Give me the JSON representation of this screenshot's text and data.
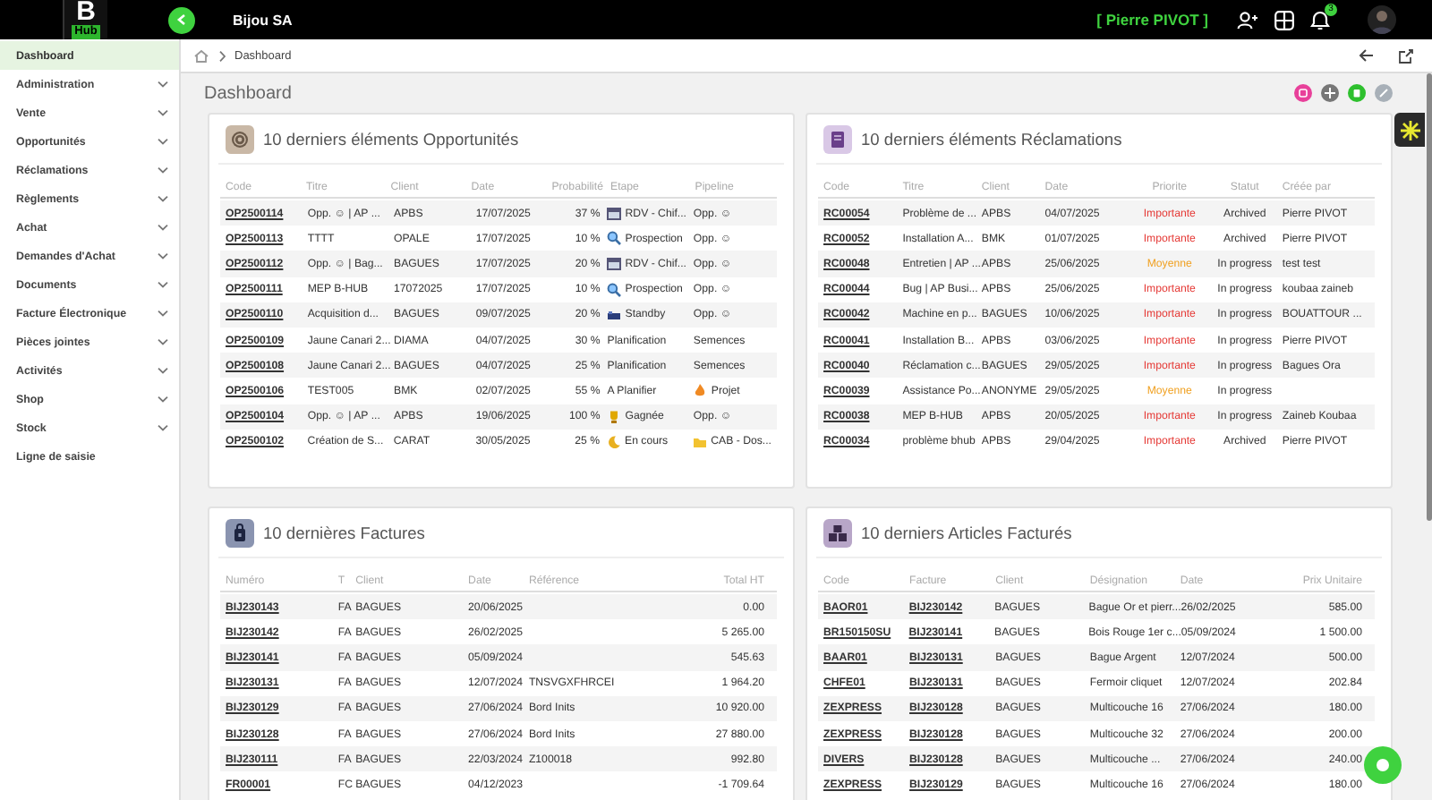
{
  "header": {
    "logo_top": "B",
    "logo_bottom": "Hub",
    "company": "Bijou SA",
    "user": "[ Pierre PIVOT ]",
    "notification_count": "3"
  },
  "sidebar": {
    "items": [
      {
        "label": "Dashboard",
        "selected": true,
        "expandable": false
      },
      {
        "label": "Administration",
        "selected": false,
        "expandable": true
      },
      {
        "label": "Vente",
        "selected": false,
        "expandable": true
      },
      {
        "label": "Opportunités",
        "selected": false,
        "expandable": true
      },
      {
        "label": "Réclamations",
        "selected": false,
        "expandable": true
      },
      {
        "label": "Règlements",
        "selected": false,
        "expandable": true
      },
      {
        "label": "Achat",
        "selected": false,
        "expandable": true
      },
      {
        "label": "Demandes d'Achat",
        "selected": false,
        "expandable": true
      },
      {
        "label": "Documents",
        "selected": false,
        "expandable": true
      },
      {
        "label": "Facture Électronique",
        "selected": false,
        "expandable": true
      },
      {
        "label": "Pièces jointes",
        "selected": false,
        "expandable": true
      },
      {
        "label": "Activités",
        "selected": false,
        "expandable": true
      },
      {
        "label": "Shop",
        "selected": false,
        "expandable": true
      },
      {
        "label": "Stock",
        "selected": false,
        "expandable": true
      },
      {
        "label": "Ligne de saisie",
        "selected": false,
        "expandable": false
      }
    ]
  },
  "breadcrumb": [
    "Dashboard"
  ],
  "page_title": "Dashboard",
  "cards": [
    {
      "title": "10 derniers éléments Opportunités",
      "color": "#c9b8a6",
      "columns": [
        {
          "label": "Code",
          "kind": "link"
        },
        {
          "label": "Titre",
          "kind": "text"
        },
        {
          "label": "Client",
          "kind": "text"
        },
        {
          "label": "Date",
          "kind": "text"
        },
        {
          "label": "Probabilité",
          "kind": "number"
        },
        {
          "label": "Etape",
          "kind": "text"
        },
        {
          "label": "Pipeline",
          "kind": "text"
        }
      ],
      "rows": [
        {
          "cells": [
            "OP2500114",
            "Opp. ☺ | AP ...",
            "APBS",
            "17/07/2025",
            "37 %",
            {
              "text": "RDV - Chif...",
              "kind": "calendar"
            },
            "Opp. ☺"
          ]
        },
        {
          "cells": [
            "OP2500113",
            "TTTT",
            "OPALE",
            "17/07/2025",
            "10 %",
            {
              "text": "Prospection",
              "kind": "search"
            },
            "Opp. ☺"
          ]
        },
        {
          "cells": [
            "OP2500112",
            "Opp. ☺ | Bag...",
            "BAGUES",
            "17/07/2025",
            "20 %",
            {
              "text": "RDV - Chif...",
              "kind": "calendar"
            },
            "Opp. ☺"
          ]
        },
        {
          "cells": [
            "OP2500111",
            "MEP B-HUB",
            "17072025",
            "17/07/2025",
            "10 %",
            {
              "text": "Prospection",
              "kind": "search"
            },
            "Opp. ☺"
          ]
        },
        {
          "cells": [
            "OP2500110",
            "Acquisition d...",
            "BAGUES",
            "09/07/2025",
            "20 %",
            {
              "text": "Standby",
              "kind": "bed"
            },
            "Opp. ☺"
          ]
        },
        {
          "cells": [
            "OP2500109",
            "Jaune Canari 2...",
            "DIAMA",
            "04/07/2025",
            "30 %",
            "Planification",
            "Semences"
          ]
        },
        {
          "cells": [
            "OP2500108",
            "Jaune Canari 2...",
            "BAGUES",
            "04/07/2025",
            "25 %",
            "Planification",
            "Semences"
          ]
        },
        {
          "cells": [
            "OP2500106",
            "TEST005",
            "BMK",
            "02/07/2025",
            "55 %",
            "A Planifier",
            {
              "text": "Projet",
              "kind": "flame"
            }
          ]
        },
        {
          "cells": [
            "OP2500104",
            "Opp. ☺ | AP ...",
            "APBS",
            "19/06/2025",
            "100 %",
            {
              "text": "Gagnée",
              "kind": "trophy"
            },
            "Opp. ☺"
          ]
        },
        {
          "cells": [
            "OP2500102",
            "Création de S...",
            "CARAT",
            "30/05/2025",
            "25 %",
            {
              "text": "En cours",
              "kind": "moon"
            },
            {
              "text": "CAB - Dos...",
              "kind": "folder"
            }
          ]
        }
      ]
    },
    {
      "title": "10 derniers éléments Réclamations",
      "color": "#d9c8e6",
      "columns": [
        {
          "label": "Code",
          "kind": "link"
        },
        {
          "label": "Titre",
          "kind": "text"
        },
        {
          "label": "Client",
          "kind": "text"
        },
        {
          "label": "Date",
          "kind": "text"
        },
        {
          "label": "Priorite",
          "kind": "center"
        },
        {
          "label": "Statut",
          "kind": "center"
        },
        {
          "label": "Créée par",
          "kind": "text"
        }
      ],
      "rows": [
        {
          "cells": [
            "RC00054",
            "Problème de ...",
            "APBS",
            "04/07/2025",
            {
              "text": "Importante",
              "color": "#e53935"
            },
            "Archived",
            "Pierre PIVOT"
          ]
        },
        {
          "cells": [
            "RC00052",
            "Installation A...",
            "BMK",
            "01/07/2025",
            {
              "text": "Importante",
              "color": "#e53935"
            },
            "Archived",
            "Pierre PIVOT"
          ]
        },
        {
          "cells": [
            "RC00048",
            "Entretien | AP ...",
            "APBS",
            "25/06/2025",
            {
              "text": "Moyenne",
              "color": "#f0a020"
            },
            "In progress",
            "test test"
          ]
        },
        {
          "cells": [
            "RC00044",
            "Bug | AP Busi...",
            "APBS",
            "25/06/2025",
            {
              "text": "Importante",
              "color": "#e53935"
            },
            "In progress",
            "koubaa zaineb"
          ]
        },
        {
          "cells": [
            "RC00042",
            "Machine en p...",
            "BAGUES",
            "10/06/2025",
            {
              "text": "Importante",
              "color": "#e53935"
            },
            "In progress",
            "BOUATTOUR ..."
          ]
        },
        {
          "cells": [
            "RC00041",
            "Installation B...",
            "APBS",
            "03/06/2025",
            {
              "text": "Importante",
              "color": "#e53935"
            },
            "In progress",
            "Pierre PIVOT"
          ]
        },
        {
          "cells": [
            "RC00040",
            "Réclamation c...",
            "BAGUES",
            "29/05/2025",
            {
              "text": "Importante",
              "color": "#e53935"
            },
            "In progress",
            "Bagues Ora"
          ]
        },
        {
          "cells": [
            "RC00039",
            "Assistance Po...",
            "ANONYME",
            "29/05/2025",
            {
              "text": "Moyenne",
              "color": "#f0a020"
            },
            "In progress",
            ""
          ]
        },
        {
          "cells": [
            "RC00038",
            "MEP B-HUB",
            "APBS",
            "20/05/2025",
            {
              "text": "Importante",
              "color": "#e53935"
            },
            "In progress",
            "Zaineb Koubaa"
          ]
        },
        {
          "cells": [
            "RC00034",
            "problème bhub",
            "APBS",
            "29/04/2025",
            {
              "text": "Importante",
              "color": "#e53935"
            },
            "Archived",
            "Pierre PIVOT"
          ]
        }
      ]
    },
    {
      "title": "10 dernières Factures",
      "color": "#8a94b0",
      "columns": [
        {
          "label": "Numéro",
          "kind": "link"
        },
        {
          "label": "T",
          "kind": "text"
        },
        {
          "label": "Client",
          "kind": "text"
        },
        {
          "label": "Date",
          "kind": "text"
        },
        {
          "label": "Référence",
          "kind": "text"
        },
        {
          "label": "Total HT",
          "kind": "number"
        }
      ],
      "rows": [
        {
          "cells": [
            "BIJ230143",
            "FA",
            "BAGUES",
            "20/06/2025",
            "",
            "0.00"
          ]
        },
        {
          "cells": [
            "BIJ230142",
            "FA",
            "BAGUES",
            "26/02/2025",
            "",
            "5 265.00"
          ]
        },
        {
          "cells": [
            "BIJ230141",
            "FA",
            "BAGUES",
            "05/09/2024",
            "",
            "545.63"
          ]
        },
        {
          "cells": [
            "BIJ230131",
            "FA",
            "BAGUES",
            "12/07/2024",
            "TNSVGXFHRCEI",
            "1 964.20"
          ]
        },
        {
          "cells": [
            "BIJ230129",
            "FA",
            "BAGUES",
            "27/06/2024",
            "Bord Inits",
            "10 920.00"
          ]
        },
        {
          "cells": [
            "BIJ230128",
            "FA",
            "BAGUES",
            "27/06/2024",
            "Bord Inits",
            "27 880.00"
          ]
        },
        {
          "cells": [
            "BIJ230111",
            "FA",
            "BAGUES",
            "22/03/2024",
            "Z100018",
            "992.80"
          ]
        },
        {
          "cells": [
            "FR00001",
            "FC",
            "BAGUES",
            "04/12/2023",
            "",
            "-1 709.64"
          ]
        }
      ]
    },
    {
      "title": "10 derniers Articles Facturés",
      "color": "#b8a6c8",
      "columns": [
        {
          "label": "Code",
          "kind": "link"
        },
        {
          "label": "Facture",
          "kind": "link"
        },
        {
          "label": "Client",
          "kind": "text"
        },
        {
          "label": "Désignation",
          "kind": "text"
        },
        {
          "label": "Date",
          "kind": "text"
        },
        {
          "label": "Prix Unitaire",
          "kind": "number"
        }
      ],
      "rows": [
        {
          "cells": [
            "BAOR01",
            "BIJ230142",
            "BAGUES",
            "Bague Or et pierr...",
            "26/02/2025",
            "585.00"
          ]
        },
        {
          "cells": [
            "BR150150SU",
            "BIJ230141",
            "BAGUES",
            "Bois Rouge 1er c...",
            "05/09/2024",
            "1 500.00"
          ]
        },
        {
          "cells": [
            "BAAR01",
            "BIJ230131",
            "BAGUES",
            "Bague Argent",
            "12/07/2024",
            "500.00"
          ]
        },
        {
          "cells": [
            "CHFE01",
            "BIJ230131",
            "BAGUES",
            "Fermoir cliquet",
            "12/07/2024",
            "202.84"
          ]
        },
        {
          "cells": [
            "ZEXPRESS",
            "BIJ230128",
            "BAGUES",
            "Multicouche 16",
            "27/06/2024",
            "180.00"
          ]
        },
        {
          "cells": [
            "ZEXPRESS",
            "BIJ230128",
            "BAGUES",
            "Multicouche 32",
            "27/06/2024",
            "200.00"
          ]
        },
        {
          "cells": [
            "DIVERS",
            "BIJ230128",
            "BAGUES",
            "Multicouche ...",
            "27/06/2024",
            "240.00"
          ]
        },
        {
          "cells": [
            "ZEXPRESS",
            "BIJ230129",
            "BAGUES",
            "Multicouche 16",
            "27/06/2024",
            "180.00"
          ]
        }
      ]
    }
  ]
}
